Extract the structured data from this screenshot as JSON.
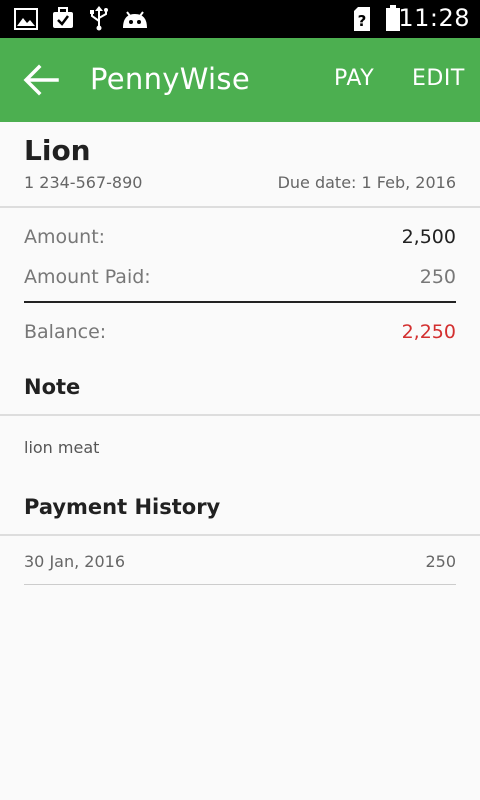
{
  "status_bar": {
    "time": "11:28",
    "icons": [
      "gallery-icon",
      "briefcase-check-icon",
      "usb-icon",
      "android-icon",
      "sim-unknown-icon",
      "battery-icon"
    ]
  },
  "app_bar": {
    "title": "PennyWise",
    "actions": {
      "pay": "PAY",
      "edit": "EDIT"
    },
    "back_icon": "arrow-back-icon",
    "color": "#4caf50"
  },
  "bill": {
    "name": "Lion",
    "phone": "1 234-567-890",
    "due_date": "Due date: 1 Feb, 2016"
  },
  "summary": {
    "amount_label": "Amount:",
    "amount_value": "2,500",
    "paid_label": "Amount Paid:",
    "paid_value": "250",
    "balance_label": "Balance:",
    "balance_value": "2,250",
    "balance_color": "#d32f2f"
  },
  "note": {
    "title": "Note",
    "text": "lion meat"
  },
  "payment_history": {
    "title": "Payment History",
    "items": [
      {
        "date": "30 Jan, 2016",
        "amount": "250"
      }
    ]
  }
}
